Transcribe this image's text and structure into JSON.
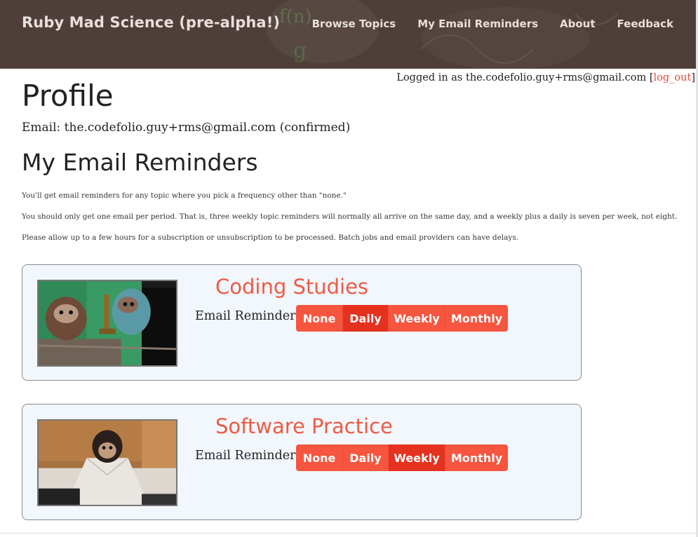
{
  "navbar": {
    "brand": "Ruby Mad Science (pre-alpha!)",
    "links": [
      "Browse Topics",
      "My Email Reminders",
      "About",
      "Feedback"
    ],
    "background_color": "#4f3f3a"
  },
  "login": {
    "prefix": "Logged in as the.codefolio.guy+rms@gmail.com [",
    "link_label": "log_out",
    "suffix": "]"
  },
  "profile": {
    "title": "Profile",
    "email_line": "Email: the.codefolio.guy+rms@gmail.com (confirmed)"
  },
  "reminders": {
    "title": "My Email Reminders",
    "notes": [
      "You'll get email reminders for any topic where you pick a frequency other than \"none.\"",
      "You should only get one email per period. That is, three weekly topic reminders will normally all arrive on the same day, and a weekly plus a daily is seven per week, not eight.",
      "Please allow up to a few hours for a subscription or unsubscription to be processed. Batch jobs and email providers can have delays."
    ],
    "label": "Email Reminders:",
    "frequency_options": [
      "None",
      "Daily",
      "Weekly",
      "Monthly"
    ],
    "topics": [
      {
        "title": "Coding Studies",
        "selected": "Daily",
        "image_icon": "monkey-scientist-microscope-image"
      },
      {
        "title": "Software Practice",
        "selected": "Weekly",
        "image_icon": "monkey-lab-coat-keyboard-image"
      }
    ]
  },
  "colors": {
    "accent": "#f6553f",
    "accent_active": "#e4321f",
    "card_background": "#f1f7fc",
    "link": "#e8493b"
  }
}
